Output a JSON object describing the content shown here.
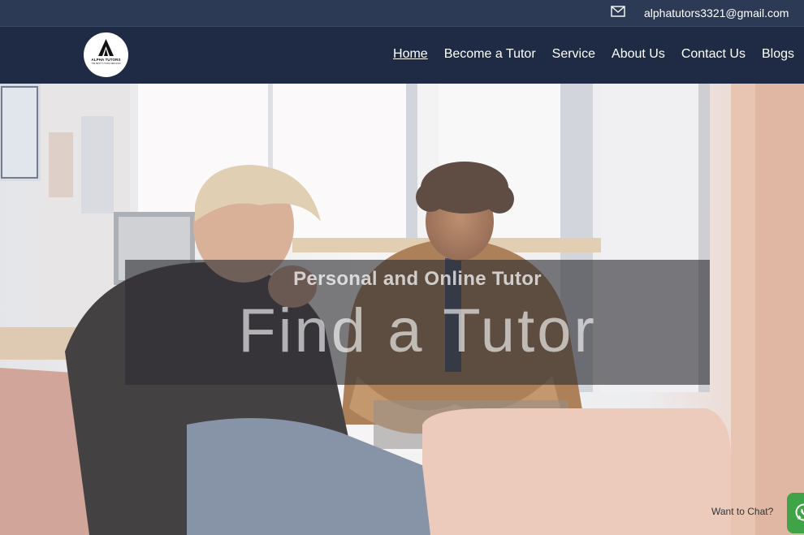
{
  "header": {
    "email": "alphatutors3321@gmail.com",
    "email_icon": "envelope-icon"
  },
  "logo": {
    "name": "ALPHA TUTORS",
    "tagline": "THE BEST TUTORS SERVICES"
  },
  "nav": {
    "items": [
      {
        "label": "Home",
        "active": true
      },
      {
        "label": "Become a Tutor",
        "active": false
      },
      {
        "label": "Service",
        "active": false
      },
      {
        "label": "About Us",
        "active": false
      },
      {
        "label": "Contact Us",
        "active": false
      },
      {
        "label": "Blogs",
        "active": false
      }
    ]
  },
  "hero": {
    "subtitle": "Personal and Online Tutor",
    "title": "Find a Tutor"
  },
  "chat": {
    "label": "Want to Chat?",
    "icon": "whatsapp-icon",
    "color": "#3fa348"
  },
  "colors": {
    "topbar": "#2d3a55",
    "navbar": "#1f2b44"
  }
}
